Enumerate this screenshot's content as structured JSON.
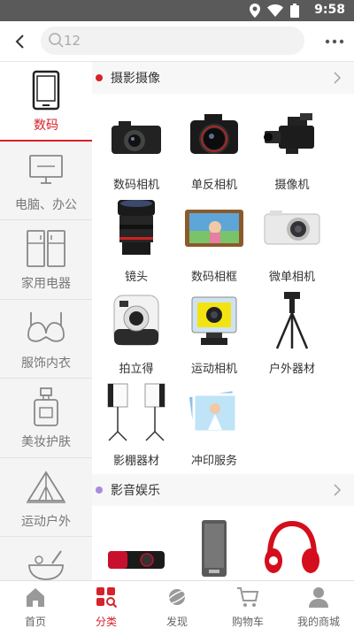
{
  "status_bar": {
    "time": "9:58"
  },
  "header": {
    "search_value": "12"
  },
  "sidebar": {
    "items": [
      {
        "label": "数码",
        "active": true
      },
      {
        "label": "电脑、办公"
      },
      {
        "label": "家用电器"
      },
      {
        "label": "服饰内衣"
      },
      {
        "label": "美妆护肤"
      },
      {
        "label": "运动户外"
      },
      {
        "label": ""
      }
    ]
  },
  "sections": [
    {
      "title": "摄影摄像",
      "dot_color": "#d6222a",
      "products": [
        "数码相机",
        "单反相机",
        "摄像机",
        "镜头",
        "数码相框",
        "微单相机",
        "拍立得",
        "运动相机",
        "户外器材",
        "影棚器材",
        "冲印服务"
      ]
    },
    {
      "title": "影音娱乐",
      "dot_color": "#a98be0",
      "products": [
        "",
        "",
        ""
      ]
    }
  ],
  "bottom_nav": {
    "items": [
      {
        "label": "首页"
      },
      {
        "label": "分类",
        "active": true
      },
      {
        "label": "发现"
      },
      {
        "label": "购物车"
      },
      {
        "label": "我的商城"
      }
    ]
  },
  "colors": {
    "accent": "#d6222a",
    "status_bar": "#5a5a5a"
  }
}
